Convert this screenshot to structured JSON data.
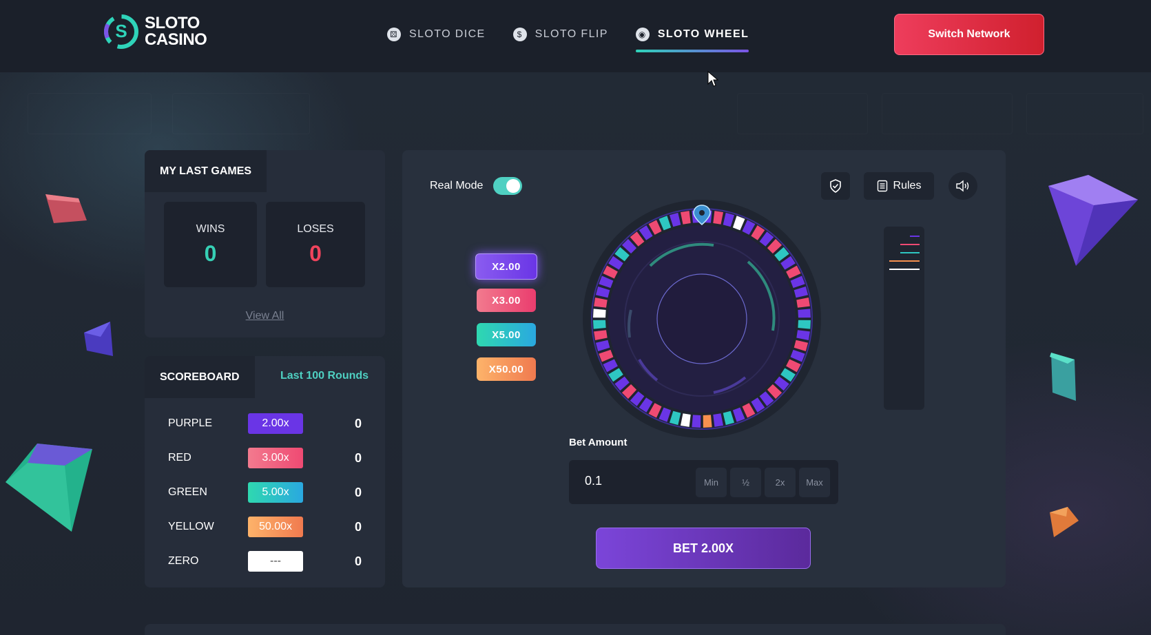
{
  "header": {
    "logo_line1": "SLOTO",
    "logo_line2": "CASINO",
    "nav": [
      {
        "label": "SLOTO DICE",
        "icon": "dice-icon",
        "active": false
      },
      {
        "label": "SLOTO FLIP",
        "icon": "coin-icon",
        "active": false
      },
      {
        "label": "SLOTO WHEEL",
        "icon": "wheel-icon",
        "active": true
      }
    ],
    "switch_network": "Switch Network"
  },
  "last_games": {
    "title": "MY LAST GAMES",
    "wins_label": "WINS",
    "wins_value": "0",
    "loses_label": "LOSES",
    "loses_value": "0",
    "view_all": "View All"
  },
  "scoreboard": {
    "title": "SCOREBOARD",
    "tab": "Last 100 Rounds",
    "rows": [
      {
        "label": "PURPLE",
        "multiplier": "2.00x",
        "count": "0",
        "color": "#6a35e6"
      },
      {
        "label": "RED",
        "multiplier": "3.00x",
        "count": "0",
        "color": "#ef4a73"
      },
      {
        "label": "GREEN",
        "multiplier": "5.00x",
        "count": "0",
        "color": "#2ec7c2"
      },
      {
        "label": "YELLOW",
        "multiplier": "50.00x",
        "count": "0",
        "color": "#f7914f"
      },
      {
        "label": "ZERO",
        "multiplier": "---",
        "count": "0",
        "color": "#ffffff"
      }
    ]
  },
  "game": {
    "mode_label": "Real Mode",
    "mode_on": true,
    "rules_label": "Rules",
    "multipliers": [
      "X2.00",
      "X3.00",
      "X5.00",
      "X50.00"
    ],
    "bet_amount_label": "Bet Amount",
    "bet_value": "0.1",
    "bet_chips": [
      "Min",
      "½",
      "2x",
      "Max"
    ],
    "bet_button": "BET 2.00X"
  },
  "colors": {
    "accent_teal": "#2fd3b9",
    "accent_purple": "#7b54e6",
    "accent_red": "#ee3d5c",
    "win_color": "#36d0b5",
    "lose_color": "#f0445d"
  }
}
